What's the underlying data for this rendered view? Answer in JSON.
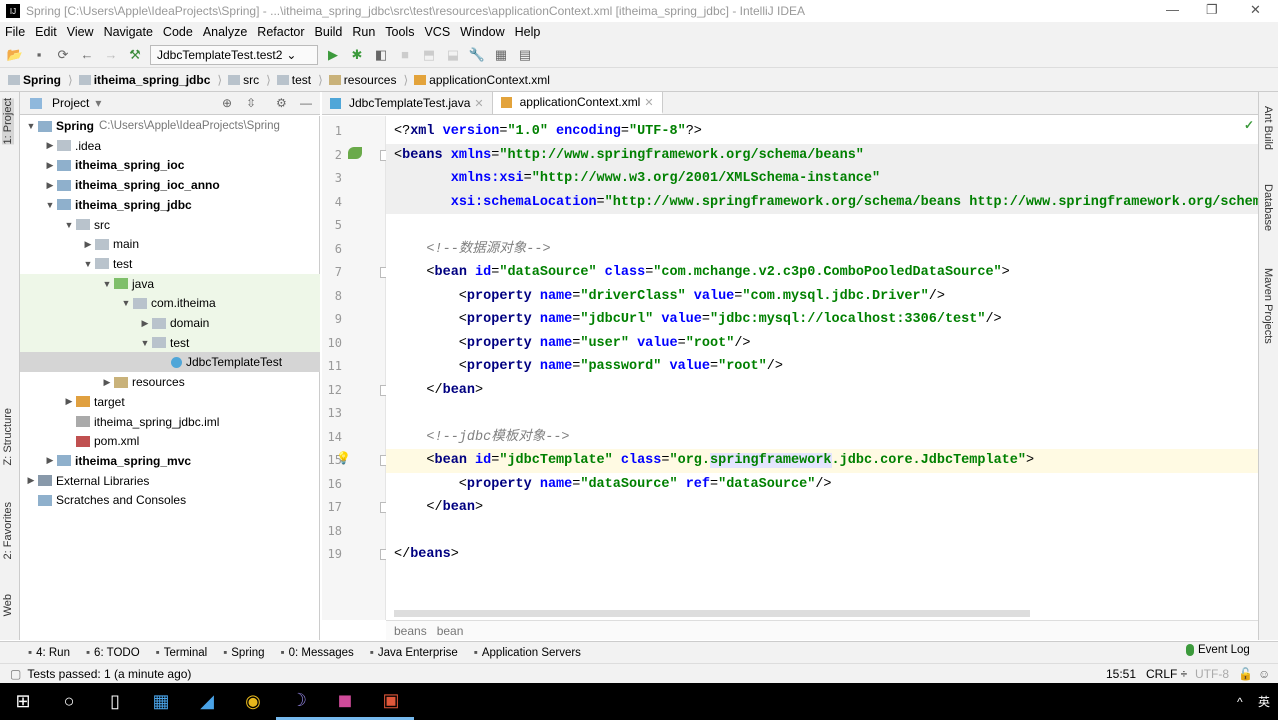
{
  "window": {
    "title": "Spring [C:\\Users\\Apple\\IdeaProjects\\Spring] - ...\\itheima_spring_jdbc\\src\\test\\resources\\applicationContext.xml [itheima_spring_jdbc] - IntelliJ IDEA",
    "minimize": "—",
    "maximize": "❐",
    "close": "✕"
  },
  "menu": [
    "File",
    "Edit",
    "View",
    "Navigate",
    "Code",
    "Analyze",
    "Refactor",
    "Build",
    "Run",
    "Tools",
    "VCS",
    "Window",
    "Help"
  ],
  "toolbar": {
    "run_config": "JdbcTemplateTest.test2"
  },
  "breadcrumbs": [
    "Spring",
    "itheima_spring_jdbc",
    "src",
    "test",
    "resources",
    "applicationContext.xml"
  ],
  "left_strip": {
    "project": "1: Project",
    "structure": "Z: Structure",
    "favorites": "2: Favorites",
    "web": "Web"
  },
  "project_panel": {
    "title": "Project"
  },
  "tree": [
    {
      "label": "Spring",
      "path": "C:\\Users\\Apple\\IdeaProjects\\Spring",
      "level": 0,
      "arrow": "open",
      "bold": true,
      "icon": "module-folder"
    },
    {
      "label": ".idea",
      "level": 1,
      "arrow": "closed",
      "icon": "folder"
    },
    {
      "label": "itheima_spring_ioc",
      "level": 1,
      "arrow": "closed",
      "bold": true,
      "icon": "module-folder"
    },
    {
      "label": "itheima_spring_ioc_anno",
      "level": 1,
      "arrow": "closed",
      "bold": true,
      "icon": "module-folder"
    },
    {
      "label": "itheima_spring_jdbc",
      "level": 1,
      "arrow": "open",
      "bold": true,
      "icon": "module-folder"
    },
    {
      "label": "src",
      "level": 2,
      "arrow": "open",
      "icon": "folder"
    },
    {
      "label": "main",
      "level": 3,
      "arrow": "closed",
      "icon": "folder"
    },
    {
      "label": "test",
      "level": 3,
      "arrow": "open",
      "icon": "folder"
    },
    {
      "label": "java",
      "level": 4,
      "arrow": "open",
      "icon": "test-folder",
      "hl": true
    },
    {
      "label": "com.itheima",
      "level": 5,
      "arrow": "open",
      "icon": "package",
      "hl": true
    },
    {
      "label": "domain",
      "level": 6,
      "arrow": "closed",
      "icon": "package",
      "hl": true
    },
    {
      "label": "test",
      "level": 6,
      "arrow": "open",
      "icon": "package",
      "hl": true
    },
    {
      "label": "JdbcTemplateTest",
      "level": 7,
      "arrow": "none",
      "icon": "class",
      "selected": true
    },
    {
      "label": "resources",
      "level": 4,
      "arrow": "closed",
      "icon": "resources-folder"
    },
    {
      "label": "target",
      "level": 2,
      "arrow": "closed",
      "icon": "excluded-folder"
    },
    {
      "label": "itheima_spring_jdbc.iml",
      "level": 2,
      "arrow": "none",
      "icon": "iml-file"
    },
    {
      "label": "pom.xml",
      "level": 2,
      "arrow": "none",
      "icon": "maven-file"
    },
    {
      "label": "itheima_spring_mvc",
      "level": 1,
      "arrow": "closed",
      "bold": true,
      "icon": "module-folder"
    },
    {
      "label": "External Libraries",
      "level": 0,
      "arrow": "closed",
      "icon": "libraries"
    },
    {
      "label": "Scratches and Consoles",
      "level": 0,
      "arrow": "none",
      "icon": "scratches"
    }
  ],
  "tabs": [
    {
      "label": "JdbcTemplateTest.java",
      "icon": "class"
    },
    {
      "label": "applicationContext.xml",
      "icon": "xml",
      "active": true
    }
  ],
  "editor": {
    "current_line": 15,
    "lines": [
      [
        [
          "pun",
          "<?"
        ],
        [
          "tag",
          "xml "
        ],
        [
          "attr",
          "version"
        ],
        [
          "pun",
          "="
        ],
        [
          "val",
          "\"1.0\" "
        ],
        [
          "attr",
          "encoding"
        ],
        [
          "pun",
          "="
        ],
        [
          "val",
          "\"UTF-8\""
        ],
        [
          "pun",
          "?>"
        ]
      ],
      [
        [
          "pun",
          "<"
        ],
        [
          "tag",
          "beans "
        ],
        [
          "attr",
          "xmlns"
        ],
        [
          "pun",
          "="
        ],
        [
          "val",
          "\"http://www.springframework.org/schema/beans\""
        ]
      ],
      [
        [
          "pun",
          "       "
        ],
        [
          "attr",
          "xmlns:xsi"
        ],
        [
          "pun",
          "="
        ],
        [
          "val",
          "\"http://www.w3.org/2001/XMLSchema-instance\""
        ]
      ],
      [
        [
          "pun",
          "       "
        ],
        [
          "attr",
          "xsi:schemaLocation"
        ],
        [
          "pun",
          "="
        ],
        [
          "val",
          "\"http://www.springframework.org/schema/beans http://www.springframework.org/schema/beans/spring-beans.xsd\""
        ]
      ],
      [],
      [
        [
          "com",
          "    <!--数据源对象-->"
        ]
      ],
      [
        [
          "pun",
          "    <"
        ],
        [
          "tag",
          "bean "
        ],
        [
          "attr",
          "id"
        ],
        [
          "pun",
          "="
        ],
        [
          "val",
          "\"dataSource\" "
        ],
        [
          "attr",
          "class"
        ],
        [
          "pun",
          "="
        ],
        [
          "val",
          "\"com.mchange.v2.c3p0.ComboPooledDataSource\""
        ],
        [
          "pun",
          ">"
        ]
      ],
      [
        [
          "pun",
          "        <"
        ],
        [
          "tag",
          "property "
        ],
        [
          "attr",
          "name"
        ],
        [
          "pun",
          "="
        ],
        [
          "val",
          "\"driverClass\" "
        ],
        [
          "attr",
          "value"
        ],
        [
          "pun",
          "="
        ],
        [
          "val",
          "\"com.mysql.jdbc.Driver\""
        ],
        [
          "pun",
          "/>"
        ]
      ],
      [
        [
          "pun",
          "        <"
        ],
        [
          "tag",
          "property "
        ],
        [
          "attr",
          "name"
        ],
        [
          "pun",
          "="
        ],
        [
          "val",
          "\"jdbcUrl\" "
        ],
        [
          "attr",
          "value"
        ],
        [
          "pun",
          "="
        ],
        [
          "val",
          "\"jdbc:mysql://localhost:3306/test\""
        ],
        [
          "pun",
          "/>"
        ]
      ],
      [
        [
          "pun",
          "        <"
        ],
        [
          "tag",
          "property "
        ],
        [
          "attr",
          "name"
        ],
        [
          "pun",
          "="
        ],
        [
          "val",
          "\"user\" "
        ],
        [
          "attr",
          "value"
        ],
        [
          "pun",
          "="
        ],
        [
          "val",
          "\"root\""
        ],
        [
          "pun",
          "/>"
        ]
      ],
      [
        [
          "pun",
          "        <"
        ],
        [
          "tag",
          "property "
        ],
        [
          "attr",
          "name"
        ],
        [
          "pun",
          "="
        ],
        [
          "val",
          "\"password\" "
        ],
        [
          "attr",
          "value"
        ],
        [
          "pun",
          "="
        ],
        [
          "val",
          "\"root\""
        ],
        [
          "pun",
          "/>"
        ]
      ],
      [
        [
          "pun",
          "    </"
        ],
        [
          "tag",
          "bean"
        ],
        [
          "pun",
          ">"
        ]
      ],
      [],
      [
        [
          "com",
          "    <!--jdbc模板对象-->"
        ]
      ],
      [
        [
          "pun",
          "    <"
        ],
        [
          "tag",
          "bean "
        ],
        [
          "attr",
          "id"
        ],
        [
          "pun",
          "="
        ],
        [
          "val",
          "\"jdbcTemplate\" "
        ],
        [
          "attr",
          "class"
        ],
        [
          "pun",
          "="
        ],
        [
          "val",
          "\"org."
        ],
        [
          "sel",
          "springframework"
        ],
        [
          "val",
          ".jdbc.core.JdbcTemplate\""
        ],
        [
          "pun",
          ">"
        ]
      ],
      [
        [
          "pun",
          "        <"
        ],
        [
          "tag",
          "property "
        ],
        [
          "attr",
          "name"
        ],
        [
          "pun",
          "="
        ],
        [
          "val",
          "\"dataSource\" "
        ],
        [
          "attr",
          "ref"
        ],
        [
          "pun",
          "="
        ],
        [
          "val",
          "\"dataSource\""
        ],
        [
          "pun",
          "/>"
        ]
      ],
      [
        [
          "pun",
          "    </"
        ],
        [
          "tag",
          "bean"
        ],
        [
          "pun",
          ">"
        ]
      ],
      [],
      [
        [
          "pun",
          "</"
        ],
        [
          "tag",
          "beans"
        ],
        [
          "pun",
          ">"
        ]
      ]
    ]
  },
  "editor_breadcrumb": [
    "beans",
    "bean"
  ],
  "right_strip": [
    "Ant Build",
    "Database",
    "Maven Projects"
  ],
  "tool_windows": [
    {
      "label": "4: Run",
      "icon": "run-icon"
    },
    {
      "label": "6: TODO",
      "icon": "todo-icon"
    },
    {
      "label": "Terminal",
      "icon": "terminal-icon"
    },
    {
      "label": "Spring",
      "icon": "spring-icon"
    },
    {
      "label": "0: Messages",
      "icon": "messages-icon"
    },
    {
      "label": "Java Enterprise",
      "icon": "java-enterprise-icon"
    },
    {
      "label": "Application Servers",
      "icon": "servers-icon"
    }
  ],
  "event_log": "Event Log",
  "status": {
    "message": "Tests passed: 1 (a minute ago)",
    "position": "15:51",
    "line_sep": "CRLF ÷",
    "encoding": "UTF-8"
  },
  "taskbar": {
    "ime": "英",
    "chevron": "^"
  },
  "colors": {
    "tag": "#000080",
    "attr": "#0000ff",
    "value": "#008000",
    "comment": "#808080",
    "current_line": "#fffae3"
  }
}
